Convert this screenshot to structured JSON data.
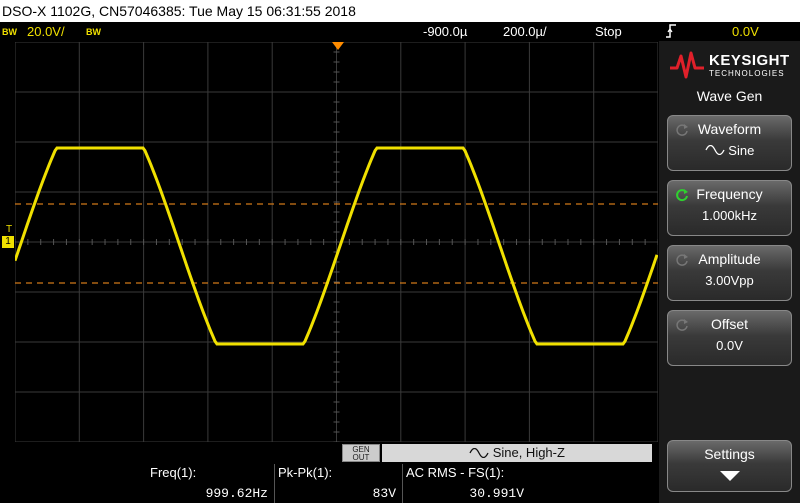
{
  "title_bar": {
    "text": "DSO-X 1102G, CN57046385: Tue May 15 06:31:55 2018"
  },
  "status_bar": {
    "ch1_bw": "BW",
    "ch1_scale": "20.0V/",
    "ch2_bw": "BW",
    "horizontal_position": "-900.0µ",
    "timebase": "200.0µ/",
    "run_state": "Stop",
    "trigger_level": "0.0V",
    "trigger_edge_icon": "rising-edge-icon",
    "colors": {
      "ch1": "#f0e000",
      "trigger_marker": "#ff8c00"
    }
  },
  "screen": {
    "trigger_marker_label": "T",
    "ground_marker_label": "1"
  },
  "wavegen_bar": {
    "gen_out_label_top": "GEN",
    "gen_out_label_bottom": "OUT",
    "status_text": "Sine, High-Z",
    "wave_icon": "sine-wave-icon"
  },
  "measurements": [
    {
      "label": "Freq(1):",
      "value": "999.62Hz"
    },
    {
      "label": "Pk-Pk(1):",
      "value": "83V"
    },
    {
      "label": "AC RMS - FS(1):",
      "value": "30.991V"
    }
  ],
  "sidebar": {
    "logo_brand": "KEYSIGHT",
    "logo_sub": "TECHNOLOGIES",
    "menu_title": "Wave Gen",
    "softkeys": [
      {
        "label": "Waveform",
        "value": "Sine",
        "active": false
      },
      {
        "label": "Frequency",
        "value": "1.000kHz",
        "active": true
      },
      {
        "label": "Amplitude",
        "value": "3.00Vpp",
        "active": false
      },
      {
        "label": "Offset",
        "value": "0.0V",
        "active": false
      }
    ],
    "settings_label": "Settings"
  }
}
